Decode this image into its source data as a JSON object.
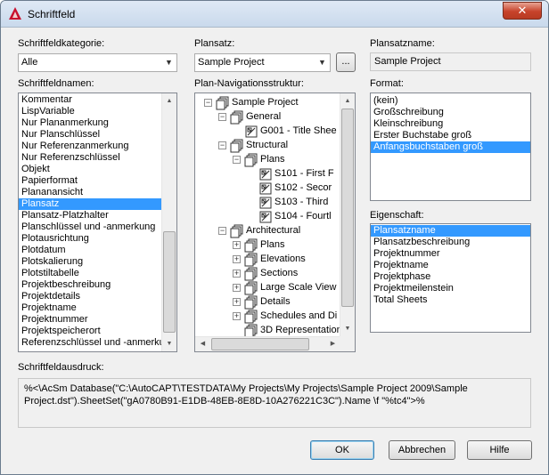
{
  "window": {
    "title": "Schriftfeld",
    "close_glyph": "✕"
  },
  "left": {
    "category_label": "Schriftfeldkategorie:",
    "category_value": "Alle",
    "names_label": "Schriftfeldnamen:",
    "names": [
      "Kommentar",
      "LispVariable",
      "Nur Plananmerkung",
      "Nur Planschlüssel",
      "Nur Referenzanmerkung",
      "Nur Referenzschlüssel",
      "Objekt",
      "Papierformat",
      "Plananansicht",
      "Plansatz",
      "Plansatz-Platzhalter",
      "Planschlüssel und -anmerkung",
      "Plotausrichtung",
      "Plotdatum",
      "Plotskalierung",
      "Plotstiltabelle",
      "Projektbeschreibung",
      "Projektdetails",
      "Projektname",
      "Projektnummer",
      "Projektspeicherort",
      "Referenzschlüssel und -anmerkung"
    ],
    "names_selected_index": 9
  },
  "middle": {
    "sheetset_label": "Plansatz:",
    "sheetset_value": "Sample Project",
    "browse_label": "...",
    "tree_label": "Plan-Navigationsstruktur:",
    "tree": [
      {
        "label": "Sample Project",
        "level": 0,
        "kind": "sheetset",
        "expander": "−"
      },
      {
        "label": "General",
        "level": 1,
        "kind": "sheetset",
        "expander": "−"
      },
      {
        "label": "G001 - Title Shee",
        "level": 2,
        "kind": "sheet",
        "expander": ""
      },
      {
        "label": "Structural",
        "level": 1,
        "kind": "sheetset",
        "expander": "−"
      },
      {
        "label": "Plans",
        "level": 2,
        "kind": "sheetset",
        "expander": "−"
      },
      {
        "label": "S101 - First F",
        "level": 3,
        "kind": "sheet",
        "expander": ""
      },
      {
        "label": "S102 - Secor",
        "level": 3,
        "kind": "sheet",
        "expander": ""
      },
      {
        "label": "S103 - Third",
        "level": 3,
        "kind": "sheet",
        "expander": ""
      },
      {
        "label": "S104 - Fourtl",
        "level": 3,
        "kind": "sheet",
        "expander": ""
      },
      {
        "label": "Architectural",
        "level": 1,
        "kind": "sheetset",
        "expander": "−"
      },
      {
        "label": "Plans",
        "level": 2,
        "kind": "sheetset",
        "expander": "+"
      },
      {
        "label": "Elevations",
        "level": 2,
        "kind": "sheetset",
        "expander": "+"
      },
      {
        "label": "Sections",
        "level": 2,
        "kind": "sheetset",
        "expander": "+"
      },
      {
        "label": "Large Scale View",
        "level": 2,
        "kind": "sheetset",
        "expander": "+"
      },
      {
        "label": "Details",
        "level": 2,
        "kind": "sheetset",
        "expander": "+"
      },
      {
        "label": "Schedules and Di",
        "level": 2,
        "kind": "sheetset",
        "expander": "+"
      },
      {
        "label": "3D Representation",
        "level": 2,
        "kind": "sheetset",
        "expander": ""
      }
    ]
  },
  "right": {
    "sheetset_name_label": "Plansatzname:",
    "sheetset_name_value": "Sample Project",
    "format_label": "Format:",
    "formats": [
      "(kein)",
      "Großschreibung",
      "Kleinschreibung",
      "Erster Buchstabe groß",
      "Anfangsbuchstaben groß"
    ],
    "format_selected_index": 4,
    "property_label": "Eigenschaft:",
    "properties": [
      "Plansatzname",
      "Plansatzbeschreibung",
      "Projektnummer",
      "Projektname",
      "Projektphase",
      "Projektmeilenstein",
      "Total Sheets"
    ],
    "property_selected_index": 0
  },
  "expression": {
    "label": "Schriftfeldausdruck:",
    "value": "%<\\AcSm Database(\"C:\\AutoCAPT\\TESTDATA\\My Projects\\My Projects\\Sample Project 2009\\Sample Project.dst\").SheetSet(\"gA0780B91-E1DB-48EB-8E8D-10A276221C3C\").Name \\f \"%tc4\">%"
  },
  "buttons": {
    "ok": "OK",
    "cancel": "Abbrechen",
    "help": "Hilfe"
  },
  "colors": {
    "selection": "#3399ff",
    "title_icon": "#c8102e"
  }
}
